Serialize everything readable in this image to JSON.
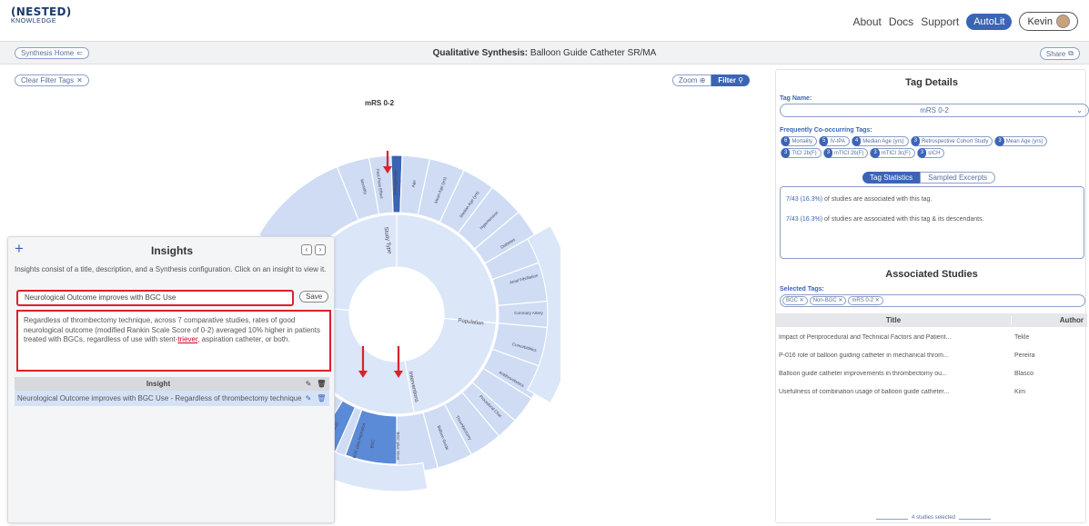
{
  "header": {
    "logo_line1": "(NESTED)",
    "logo_line2": "KNOWLEDGE",
    "nav": [
      "About",
      "Docs",
      "Support"
    ],
    "autolit_label": "AutoLit",
    "user_label": "Kevin"
  },
  "subbar": {
    "synthesis_home": "Synthesis Home",
    "title_bold": "Qualitative Synthesis:",
    "title_rest": " Balloon Guide Catheter SR/MA",
    "share": "Share"
  },
  "main": {
    "clear_filter_tags": "Clear Filter Tags",
    "zoom": "Zoom",
    "filter": "Filter",
    "chart_title": "mRS 0-2"
  },
  "sunburst": {
    "inner": [
      {
        "label": "Population"
      },
      {
        "label": "Interventions"
      },
      {
        "label": "Outcomes"
      },
      {
        "label": "Study Type"
      }
    ],
    "outer_labels": [
      "Mortality",
      "First-Pass Effect",
      "Retrospective",
      "Age",
      "Mean Age (yrs)",
      "Median Age (yrs)",
      "Hypertension",
      "Diabetes",
      "Atrial Fibrillation",
      "Coronary Artery",
      "Comorbidities",
      "Antithrombotics",
      "Procedural Char.",
      "Thrombectomy",
      "Balloon Guide",
      "BGC",
      "Non-BGC",
      "Stent-retriever",
      "Aspiration",
      "Both",
      "sICH",
      "Any ICH",
      "BGC plus Stent",
      "BGC plus Aspiration"
    ]
  },
  "insights": {
    "title": "Insights",
    "description": "Insights consist of a title, description, and a Synthesis configuration. Click on an insight to view it.",
    "input_value": "Neurological Outcome improves with BGC Use",
    "save": "Save",
    "text_before": "Regardless of thrombectomy technique, across 7 comparative studies, rates of good neurological outcome (modified Rankin Scale Score of 0-2) averaged 10% higher in patients treated with BGCs, regardless of use with stent-",
    "text_link": "triever",
    "text_after": ", aspiration catheter, or both.",
    "table_header": "Insight",
    "rows": [
      "Neurological Outcome improves with BGC Use - Regardless of thrombectomy technique, across 7 comparative studies"
    ]
  },
  "tag_details": {
    "title": "Tag Details",
    "tag_name_label": "Tag Name:",
    "tag_name_value": "mRS 0-2",
    "cooccurring_label": "Frequently Co-occurring Tags:",
    "cooccurring": [
      {
        "count": "6",
        "name": "Mortality"
      },
      {
        "count": "5",
        "name": "IV-tPA"
      },
      {
        "count": "4",
        "name": "Median Age (yrs)"
      },
      {
        "count": "3",
        "name": "Retrospective Cohort Study"
      },
      {
        "count": "3",
        "name": "Mean Age (yrs)"
      },
      {
        "count": "3",
        "name": "TICI 2b(F)"
      },
      {
        "count": "3",
        "name": "mTICI 2b(F)"
      },
      {
        "count": "3",
        "name": "mTICI 3c(F)"
      },
      {
        "count": "3",
        "name": "sICH"
      }
    ],
    "tab_stats": "Tag Statistics",
    "tab_excerpts": "Sampled Excerpts",
    "stat1_num": "7/43 (16.3%)",
    "stat1_text": " of studies are associated with this tag.",
    "stat2_num": "7/43 (16.3%)",
    "stat2_text": " of studies are associated with this tag & its descendants."
  },
  "associated": {
    "title": "Associated Studies",
    "selected_label": "Selected Tags:",
    "selected_tags": [
      "BGC ✕",
      "Non-BGC ✕",
      "mRS 0-2 ✕"
    ],
    "col_title": "Title",
    "col_author": "Author",
    "rows": [
      {
        "title": "Impact of Periprocedural and Technical Factors and Patient...",
        "author": "Tekle"
      },
      {
        "title": "P-016 role of balloon guiding catheter in mechanical throm...",
        "author": "Pereira"
      },
      {
        "title": "Balloon guide catheter improvements in thrombectomy ou...",
        "author": "Blasco"
      },
      {
        "title": "Usefulness of combination usage of balloon guide catheter...",
        "author": "Kim"
      }
    ],
    "studies_selected": "4 studies selected"
  },
  "colors": {
    "accent": "#3b64b5",
    "highlight_red": "#d9222c",
    "wedge_light": "#dbe6f8",
    "wedge_mid": "#cfdcf4",
    "wedge_selected": "#5b8ad6"
  }
}
